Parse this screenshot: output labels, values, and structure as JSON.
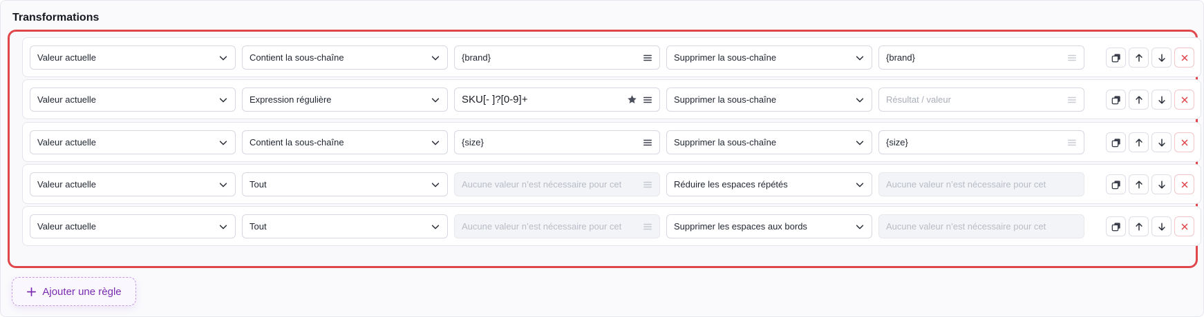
{
  "section": {
    "title": "Transformations"
  },
  "rules": [
    {
      "source": "Valeur actuelle",
      "condition": "Contient la sous-chaîne",
      "pattern": {
        "value": "{brand}",
        "placeholder": "",
        "disabled": false,
        "starred": false
      },
      "action": "Supprimer la sous-chaîne",
      "result": {
        "value": "{brand}",
        "placeholder": "",
        "disabled": false
      }
    },
    {
      "source": "Valeur actuelle",
      "condition": "Expression régulière",
      "pattern": {
        "value": "SKU[- ]?[0-9]+",
        "placeholder": "",
        "disabled": false,
        "starred": true
      },
      "action": "Supprimer la sous-chaîne",
      "result": {
        "value": "",
        "placeholder": "Résultat / valeur",
        "disabled": false
      }
    },
    {
      "source": "Valeur actuelle",
      "condition": "Contient la sous-chaîne",
      "pattern": {
        "value": "{size}",
        "placeholder": "",
        "disabled": false,
        "starred": false
      },
      "action": "Supprimer la sous-chaîne",
      "result": {
        "value": "{size}",
        "placeholder": "",
        "disabled": false
      }
    },
    {
      "source": "Valeur actuelle",
      "condition": "Tout",
      "pattern": {
        "value": "",
        "placeholder": "Aucune valeur n’est nécessaire pour cet",
        "disabled": true,
        "starred": false
      },
      "action": "Réduire les espaces répétés",
      "result": {
        "value": "",
        "placeholder": "Aucune valeur n’est nécessaire pour cet",
        "disabled": true
      }
    },
    {
      "source": "Valeur actuelle",
      "condition": "Tout",
      "pattern": {
        "value": "",
        "placeholder": "Aucune valeur n’est nécessaire pour cet",
        "disabled": true,
        "starred": false
      },
      "action": "Supprimer les espaces aux bords",
      "result": {
        "value": "",
        "placeholder": "Aucune valeur n’est nécessaire pour cet",
        "disabled": true
      }
    }
  ],
  "row_actions": [
    "duplicate-icon",
    "arrow-up-icon",
    "arrow-down-icon",
    "close-icon"
  ],
  "add_rule": {
    "label": "Ajouter une règle",
    "icon": "plus-icon"
  },
  "colors": {
    "accent": "#7a2bb0",
    "highlight": "#e0474c",
    "danger": "#e0474c"
  }
}
